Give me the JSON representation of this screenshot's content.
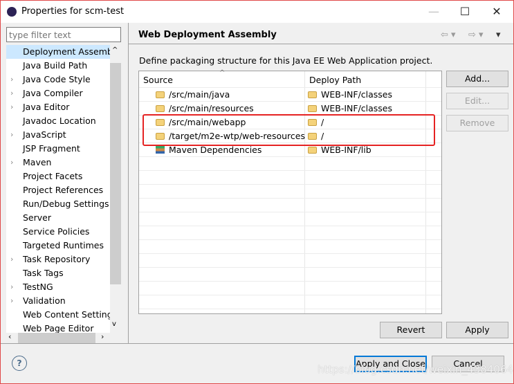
{
  "window": {
    "title": "Properties for scm-test",
    "minimize": "—",
    "maximize": "☐",
    "close": "✕"
  },
  "sidebar": {
    "filter_placeholder": "type filter text",
    "items": [
      {
        "label": "Deployment Assembly",
        "expandable": false,
        "selected": true
      },
      {
        "label": "Java Build Path",
        "expandable": false
      },
      {
        "label": "Java Code Style",
        "expandable": true
      },
      {
        "label": "Java Compiler",
        "expandable": true
      },
      {
        "label": "Java Editor",
        "expandable": true
      },
      {
        "label": "Javadoc Location",
        "expandable": false
      },
      {
        "label": "JavaScript",
        "expandable": true
      },
      {
        "label": "JSP Fragment",
        "expandable": false
      },
      {
        "label": "Maven",
        "expandable": true
      },
      {
        "label": "Project Facets",
        "expandable": false
      },
      {
        "label": "Project References",
        "expandable": false
      },
      {
        "label": "Run/Debug Settings",
        "expandable": false
      },
      {
        "label": "Server",
        "expandable": false
      },
      {
        "label": "Service Policies",
        "expandable": false
      },
      {
        "label": "Targeted Runtimes",
        "expandable": false
      },
      {
        "label": "Task Repository",
        "expandable": true
      },
      {
        "label": "Task Tags",
        "expandable": false
      },
      {
        "label": "TestNG",
        "expandable": true
      },
      {
        "label": "Validation",
        "expandable": true
      },
      {
        "label": "Web Content Settings",
        "expandable": false
      },
      {
        "label": "Web Page Editor",
        "expandable": false
      }
    ]
  },
  "page": {
    "title": "Web Deployment Assembly",
    "description": "Define packaging structure for this Java EE Web Application project.",
    "table": {
      "columns": [
        "Source",
        "Deploy Path"
      ],
      "rows": [
        {
          "source": "/src/main/java",
          "deploy": "WEB-INF/classes",
          "icon": "folder"
        },
        {
          "source": "/src/main/resources",
          "deploy": "WEB-INF/classes",
          "icon": "folder"
        },
        {
          "source": "/src/main/webapp",
          "deploy": "/",
          "icon": "folder"
        },
        {
          "source": "/target/m2e-wtp/web-resources",
          "deploy": "/",
          "icon": "folder"
        },
        {
          "source": "Maven Dependencies",
          "deploy": "WEB-INF/lib",
          "icon": "library"
        }
      ]
    },
    "buttons": {
      "add": "Add...",
      "edit": "Edit...",
      "remove": "Remove",
      "revert": "Revert",
      "apply": "Apply"
    }
  },
  "footer": {
    "apply_close": "Apply and Close",
    "cancel": "Cancel",
    "help": "?"
  },
  "watermark": "https://blog.csdn.net/weixin_43840640",
  "colors": {
    "highlight_box": "#e52222",
    "selection": "#cce8ff",
    "default_button": "#0078d7"
  }
}
